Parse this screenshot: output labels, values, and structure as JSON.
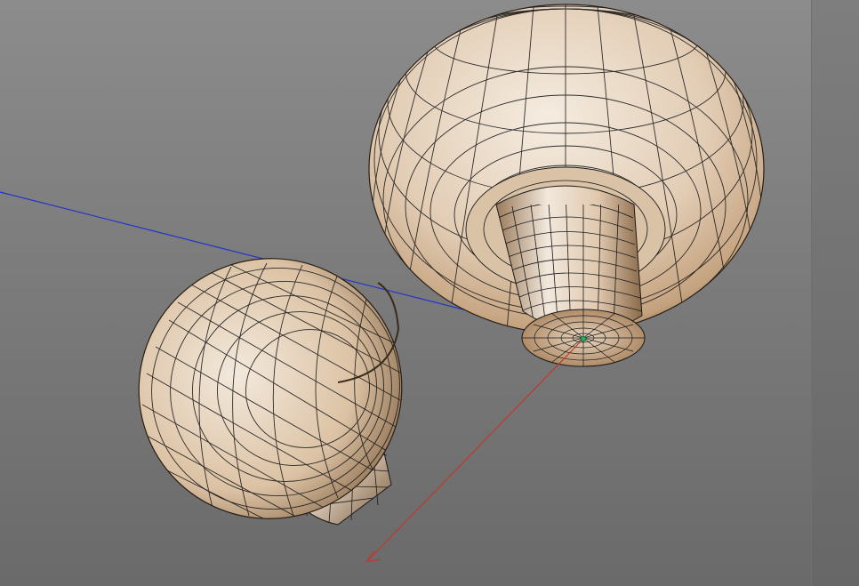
{
  "viewport": {
    "label": "",
    "background_top": "#8c8c8c",
    "background_bottom": "#6a6a6a"
  },
  "scene": {
    "objects": [
      "mushroom-large",
      "mushroom-small"
    ],
    "wireframe_color": "#1a1a1a",
    "skin_colors": [
      "#f2e6d8",
      "#d8b898",
      "#9a7450"
    ],
    "axes": {
      "x_axis_color": "#c0392b",
      "z_axis_color": "#2233cc",
      "pivot_color": "#27ae60"
    }
  }
}
